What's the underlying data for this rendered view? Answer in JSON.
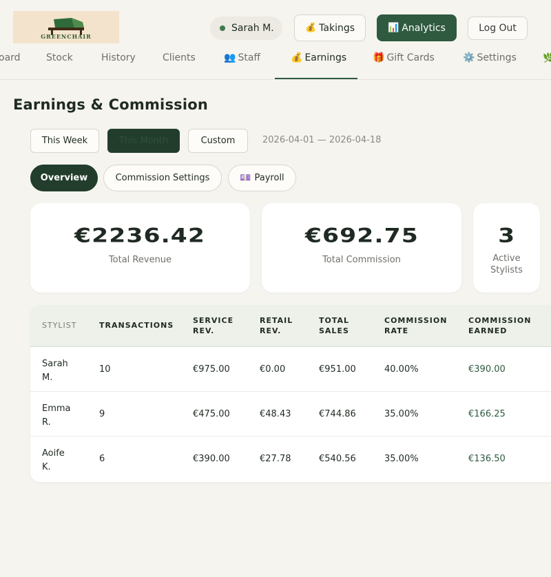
{
  "header": {
    "logo_text": "GREENCHAIR",
    "user_name": "Sarah M.",
    "takings_label": "Takings",
    "analytics_label": "Analytics",
    "logout_label": "Log Out",
    "icons": {
      "takings": "money-bag-icon",
      "analytics": "bar-chart-icon"
    }
  },
  "nav": {
    "items": [
      {
        "label": "oard",
        "icon": ""
      },
      {
        "label": "Stock",
        "icon": ""
      },
      {
        "label": "History",
        "icon": ""
      },
      {
        "label": "Clients",
        "icon": ""
      },
      {
        "label": "Staff",
        "icon": "people-icon"
      },
      {
        "label": "Earnings",
        "icon": "money-bag-icon",
        "active": true
      },
      {
        "label": "Gift Cards",
        "icon": "gift-icon"
      },
      {
        "label": "Settings",
        "icon": "gear-icon"
      }
    ]
  },
  "page": {
    "title": "Earnings & Commission"
  },
  "period": {
    "week_label": "This Week",
    "month_label": "This Month",
    "custom_label": "Custom",
    "selected": "This Month",
    "date_range": "2026-04-01 — 2026-04-18"
  },
  "tabs": {
    "overview_label": "Overview",
    "commission_label": "Commission Settings",
    "payroll_label": "Payroll",
    "selected": "Overview"
  },
  "stats": {
    "revenue": {
      "value": "€2236.42",
      "label": "Total Revenue"
    },
    "commission": {
      "value": "€692.75",
      "label": "Total Commission"
    },
    "stylists": {
      "value": "3",
      "label_line1": "Active",
      "label_line2": "Stylists"
    }
  },
  "table": {
    "headers": {
      "stylist": "STYLIST",
      "transactions": "TRANSACTIONS",
      "service_rev_1": "SERVICE",
      "service_rev_2": "REV.",
      "retail_rev_1": "RETAIL",
      "retail_rev_2": "REV.",
      "total_sales_1": "TOTAL",
      "total_sales_2": "SALES",
      "commission_rate_1": "COMMISSION",
      "commission_rate_2": "RATE",
      "commission_earned_1": "COMMISSION",
      "commission_earned_2": "EARNED"
    },
    "rows": [
      {
        "name_1": "Sarah",
        "name_2": "M.",
        "transactions": "10",
        "service": "€975.00",
        "retail": "€0.00",
        "total": "€951.00",
        "rate": "40.00%",
        "earned": "€390.00"
      },
      {
        "name_1": "Emma",
        "name_2": "R.",
        "transactions": "9",
        "service": "€475.00",
        "retail": "€48.43",
        "total": "€744.86",
        "rate": "35.00%",
        "earned": "€166.25"
      },
      {
        "name_1": "Aoife",
        "name_2": "K.",
        "transactions": "6",
        "service": "€390.00",
        "retail": "€27.78",
        "total": "€540.56",
        "rate": "35.00%",
        "earned": "€136.50"
      }
    ]
  },
  "colors": {
    "accent": "#2f5a40",
    "dark": "#223d2c",
    "background": "#f5f4ef"
  }
}
